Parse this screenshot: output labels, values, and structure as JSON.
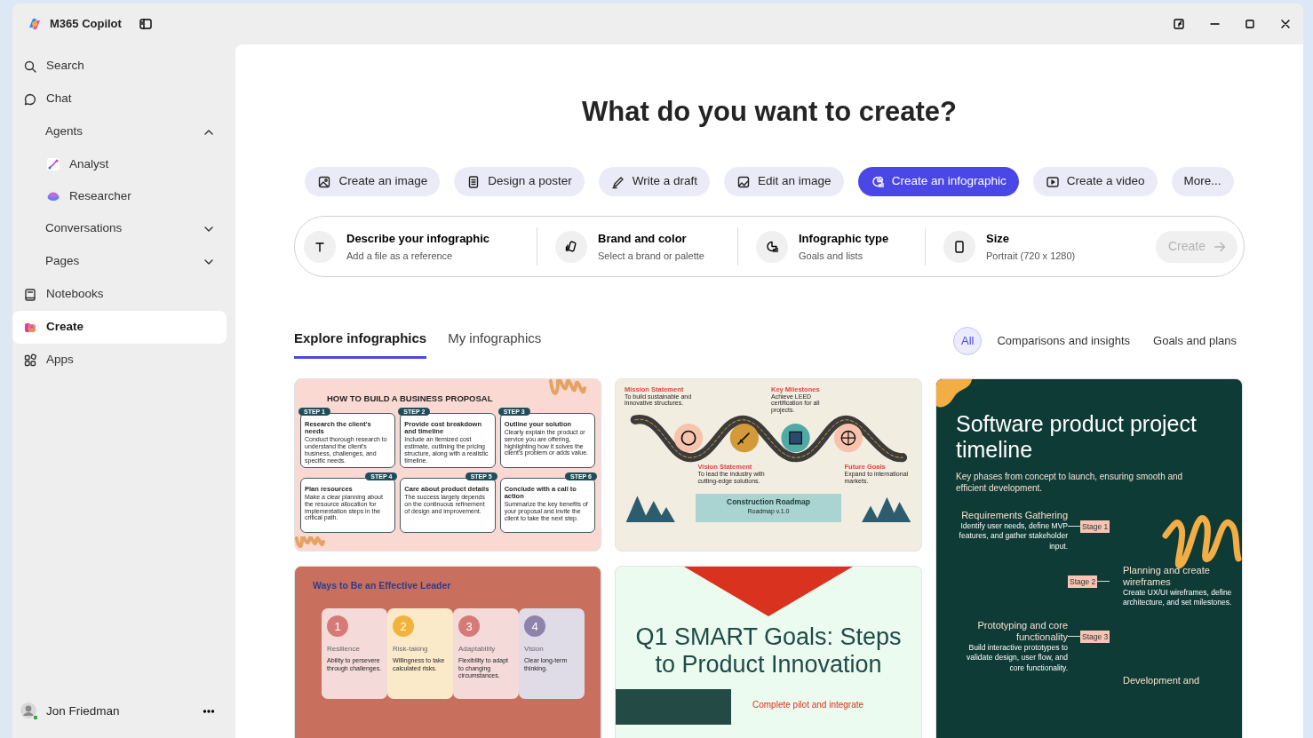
{
  "app": {
    "title": "M365 Copilot"
  },
  "sidebar": {
    "items": [
      {
        "label": "Search",
        "selected": false
      },
      {
        "label": "Chat",
        "selected": false
      },
      {
        "label": "Agents",
        "selected": false,
        "expanded": true,
        "children": [
          {
            "label": "Analyst",
            "selected": false
          },
          {
            "label": "Researcher",
            "selected": false
          }
        ]
      },
      {
        "label": "Conversations",
        "selected": false,
        "expanded": false
      },
      {
        "label": "Pages",
        "selected": false,
        "expanded": false
      },
      {
        "label": "Notebooks",
        "selected": false
      },
      {
        "label": "Create",
        "selected": true
      },
      {
        "label": "Apps",
        "selected": false
      }
    ],
    "user": {
      "name": "Jon Friedman"
    }
  },
  "heading": "What do you want to create?",
  "actions": [
    {
      "label": "Create an image",
      "selected": false
    },
    {
      "label": "Design a poster",
      "selected": false
    },
    {
      "label": "Write a draft",
      "selected": false
    },
    {
      "label": "Edit an image",
      "selected": false
    },
    {
      "label": "Create an infographic",
      "selected": true
    },
    {
      "label": "Create a video",
      "selected": false
    },
    {
      "label": "More...",
      "selected": false
    }
  ],
  "prompt": {
    "segments": [
      {
        "title": "Describe your infographic",
        "subtitle": "Add a file as a reference"
      },
      {
        "title": "Brand and color",
        "subtitle": "Select a brand or palette"
      },
      {
        "title": "Infographic type",
        "subtitle": "Goals and lists"
      },
      {
        "title": "Size",
        "subtitle": "Portrait (720 x 1280)"
      }
    ],
    "create_button": {
      "label": "Create",
      "disabled": true
    }
  },
  "tabs": [
    {
      "label": "Explore infographics",
      "selected": true
    },
    {
      "label": "My infographics",
      "selected": false
    }
  ],
  "filters": [
    {
      "label": "All",
      "selected": true
    },
    {
      "label": "Comparisons and insights",
      "selected": false
    },
    {
      "label": "Goals and plans",
      "selected": false
    }
  ],
  "gallery": [
    {
      "kind": "steps",
      "title": "HOW TO BUILD A BUSINESS PROPOSAL",
      "steps": [
        {
          "label": "STEP 1",
          "heading": "Research the client's needs",
          "body": "Conduct thorough research to understand the client's business, challenges, and specific needs."
        },
        {
          "label": "STEP 2",
          "heading": "Provide cost breakdown and timeline",
          "body": "Include an itemized cost estimate, outlining the pricing structure, along with a realistic timeline."
        },
        {
          "label": "STEP 3",
          "heading": "Outline your solution",
          "body": "Clearly explain the product or service you are offering, highlighting how it solves the client's problem or adds value."
        },
        {
          "label": "STEP 4",
          "heading": "Plan resources",
          "body": "Make a clear planning about the resource allocation for implementation steps in the critical path."
        },
        {
          "label": "STEP 5",
          "heading": "Care about product details",
          "body": "The success largely depends on the continuous refinement of design and improvement."
        },
        {
          "label": "STEP 6",
          "heading": "Conclude with a call to action",
          "body": "Summarize the key benefits of your proposal and invite the client to take the next step."
        }
      ]
    },
    {
      "kind": "roadmap",
      "items": [
        {
          "heading": "Mission Statement",
          "body": "To build sustainable and innovative structures."
        },
        {
          "heading": "Key Milestones",
          "body": "Achieve LEED certification for all projects."
        },
        {
          "heading": "Vision Statement",
          "body": "To lead the industry with cutting-edge solutions."
        },
        {
          "heading": "Future Goals",
          "body": "Expand to international markets."
        }
      ],
      "title": "Construction Roadmap",
      "subtitle": "Roadmap v.1.0"
    },
    {
      "kind": "timeline",
      "title": "Software product project timeline",
      "subtitle": "Key phases from concept to launch, ensuring smooth and efficient development.",
      "stages": [
        {
          "label": "Stage 1",
          "heading": "Requirements Gathering",
          "body": "Identify user needs, define MVP features, and gather stakeholder input."
        },
        {
          "label": "Stage 2",
          "heading": "Planning and create wireframes",
          "body": "Create UX/UI wireframes, define architecture, and set milestones."
        },
        {
          "label": "Stage 3",
          "heading": "Prototyping and core functionality",
          "body": "Build interactive prototypes to validate design, user flow, and core functionality."
        },
        {
          "heading": "Development and"
        }
      ]
    },
    {
      "kind": "leader",
      "title": "Ways to Be an Effective Leader",
      "items": [
        {
          "number": "1",
          "heading": "Resilience",
          "body": "Ability to persevere through challenges.",
          "color": "#d67a78"
        },
        {
          "number": "2",
          "heading": "Risk-taking",
          "body": "Willingness to take calculated risks.",
          "color": "#f2b33d"
        },
        {
          "number": "3",
          "heading": "Adaptability",
          "body": "Flexibility to adapt to changing circumstances.",
          "color": "#d67a78"
        },
        {
          "number": "4",
          "heading": "Vision",
          "body": "Clear long-term thinking.",
          "color": "#8e83ab"
        }
      ]
    },
    {
      "kind": "goals",
      "title": "Q1 SMART Goals: Steps to Product Innovation",
      "text": "Complete pilot and integrate"
    }
  ]
}
